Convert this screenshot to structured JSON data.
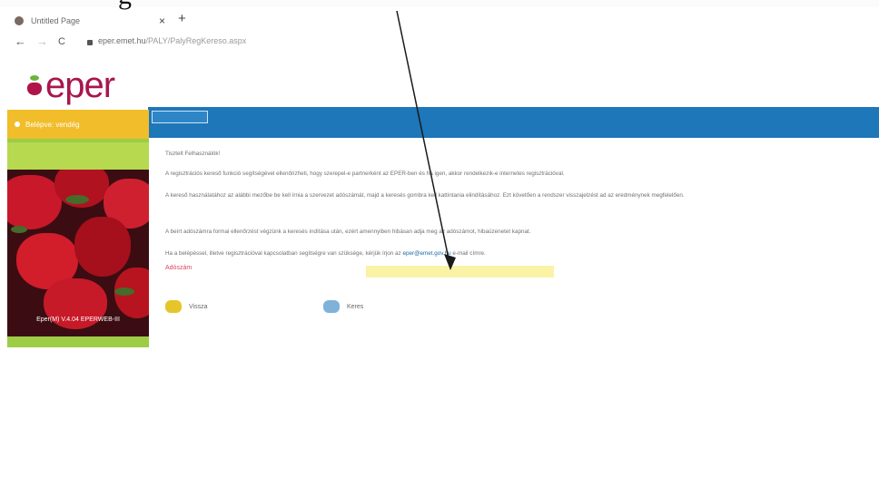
{
  "browser": {
    "tab_title": "Untitled Page",
    "tab_close": "×",
    "new_tab": "+",
    "back": "←",
    "forward": "→",
    "reload": "C",
    "url_host": "eper.emet.hu",
    "url_path": "/PALY/PalyRegKereso.aspx"
  },
  "header": {
    "logo_text": "eper",
    "logo_subtitle": ""
  },
  "annotation": {
    "text": "g"
  },
  "sidebar": {
    "user_label": "Belépve: vendég",
    "version": "Eper(M) V.4.04 EPERWEB-III"
  },
  "content": {
    "greeting": "Tisztelt Felhasználók!",
    "p1": "A regisztrációs kereső funkció segítségével ellenőrizheti, hogy szerepel-e partnerként az EPER-ben és ha igen, akkor rendelkezik-e internetes regisztrációval.",
    "p2": "A kereső használatához az alábbi mezőbe be kell írnia a szervezet adószámát, majd a keresés gombra kell kattintania elindításához. Ezt követően a rendszer visszajelzést ad az eredménynek megfelelően.",
    "p3": "A beírt adószámra formai ellenőrzést végzünk a keresés indítása után, ezért amennyiben hibásan adja meg az adószámot, hibaüzenetet kapnat.",
    "p4_before": "Ha a belépéssel, illetve regisztrációval kapcsolatban segítségre van szüksége, kérjük írjon az ",
    "p4_email": "eper@emet.gov.hu",
    "p4_after": " e-mail címre.",
    "adoszam_label": "Adószám",
    "adoszam_value": ""
  },
  "actions": {
    "back_label": "Vissza",
    "search_label": "Keres"
  },
  "colors": {
    "brand_magenta": "#a8164d",
    "sidebar_green": "#9ccd44",
    "header_yellow": "#f1bd2a",
    "bar_blue": "#1d77b9",
    "input_yellow": "#faf3a6",
    "label_red": "#d9485f"
  }
}
